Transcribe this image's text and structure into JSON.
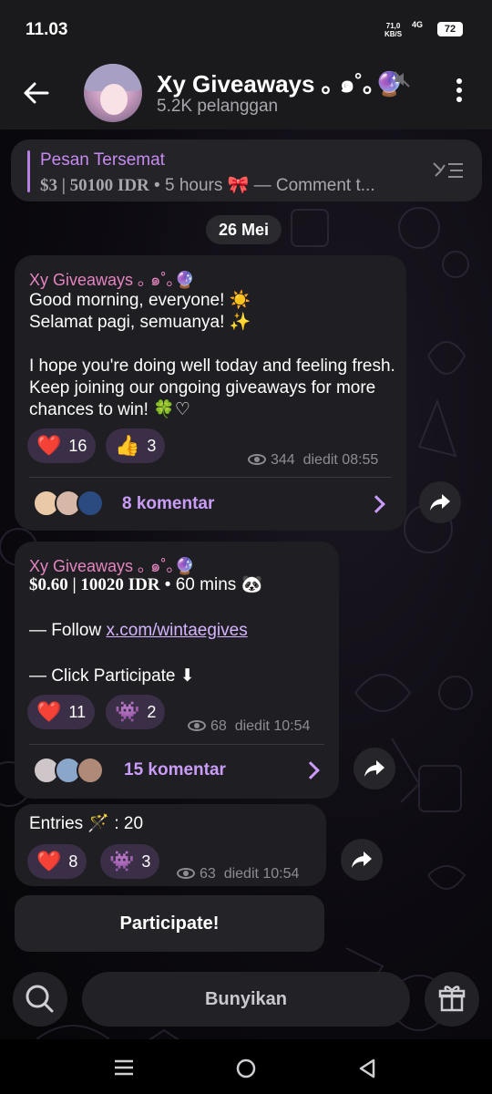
{
  "status": {
    "time": "11.03",
    "net_speed": "71,0",
    "net_unit": "KB/S",
    "signal": "4G",
    "battery": "72"
  },
  "header": {
    "title": "Xy Giveaways ｡ ๑˚｡🔮",
    "subscribers": "5.2K pelanggan"
  },
  "pinned": {
    "title": "Pesan Tersemat",
    "price_a": "$3 | 50100 IDR",
    "text": " • 5 hours 🎀 — Comment t..."
  },
  "date_chip": "26 Mei",
  "msg1": {
    "author": "Xy Giveaways ｡ ๑˚｡🔮",
    "line1": "Good morning, everyone! ☀️",
    "line2": "Selamat pagi, semuanya! ✨",
    "line3": "I hope you're doing well today and feeling fresh. Keep joining our ongoing giveaways for more chances to win! 🍀♡",
    "reactions": [
      {
        "emoji": "❤️",
        "count": "16"
      },
      {
        "emoji": "👍",
        "count": "3"
      }
    ],
    "views": "344",
    "edited": "diedit 08:55",
    "comments": "8 komentar"
  },
  "msg2": {
    "author": "Xy Giveaways ｡ ๑˚｡🔮",
    "price": "$0.60 | 10020 IDR",
    "duration": " • 60 mins 🐼",
    "follow_prefix": "— Follow ",
    "follow_link": "x.com/wintaegives",
    "click": "— Click Participate ⬇",
    "reactions": [
      {
        "emoji": "❤️",
        "count": "11"
      },
      {
        "emoji": "👾",
        "count": "2"
      }
    ],
    "views": "68",
    "edited": "diedit 10:54",
    "comments": "15 komentar"
  },
  "msg3": {
    "entries": "Entries 🪄 : 20",
    "reactions": [
      {
        "emoji": "❤️",
        "count": "8"
      },
      {
        "emoji": "👾",
        "count": "3"
      }
    ],
    "views": "63",
    "edited": "diedit 10:54"
  },
  "participate_button": "Participate!",
  "bottom": {
    "bunyikan": "Bunyikan"
  },
  "colors": {
    "accent": "#c58bf0",
    "author": "#e484c0",
    "bubble": "#1f1e22",
    "reaction": "#3a2f46"
  },
  "icons": [
    "back-arrow-icon",
    "mute-icon",
    "kebab-menu-icon",
    "pin-list-icon",
    "eye-icon",
    "chevron-right-icon",
    "share-icon",
    "search-icon",
    "gift-icon",
    "nav-recent-icon",
    "nav-home-icon",
    "nav-back-icon"
  ]
}
